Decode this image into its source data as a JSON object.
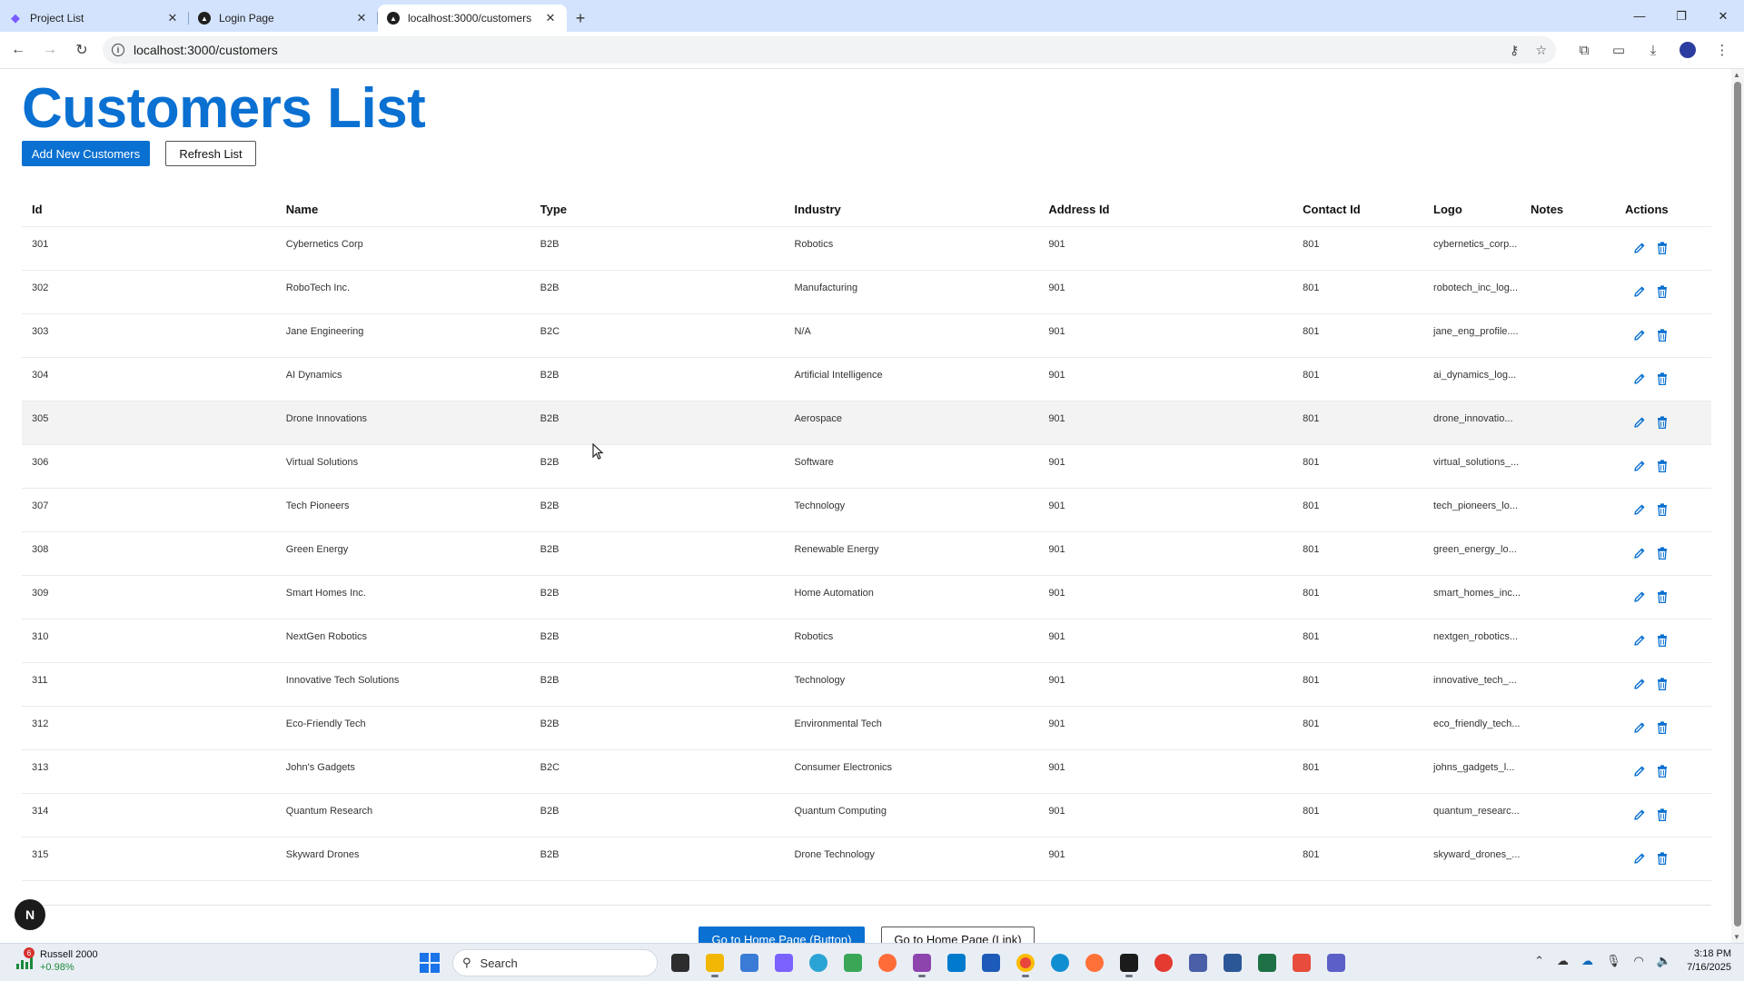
{
  "browser": {
    "tabs": [
      {
        "title": "Project List",
        "active": false
      },
      {
        "title": "Login Page",
        "active": false
      },
      {
        "title": "localhost:3000/customers",
        "active": true
      }
    ],
    "url": "localhost:3000/customers"
  },
  "page": {
    "title": "Customers List",
    "add_button": "Add New Customers",
    "refresh_button": "Refresh List",
    "home_button": "Go to Home Page (Button)",
    "home_link": "Go to Home Page (Link)",
    "next_badge": "N"
  },
  "table": {
    "headers": [
      "Id",
      "Name",
      "Type",
      "Industry",
      "Address Id",
      "Contact Id",
      "Logo",
      "Notes",
      "Actions"
    ],
    "rows": [
      {
        "id": "301",
        "name": "Cybernetics Corp",
        "type": "B2B",
        "industry": "Robotics",
        "address_id": "901",
        "contact_id": "801",
        "logo": "cybernetics_corp...",
        "notes": ""
      },
      {
        "id": "302",
        "name": "RoboTech Inc.",
        "type": "B2B",
        "industry": "Manufacturing",
        "address_id": "901",
        "contact_id": "801",
        "logo": "robotech_inc_log...",
        "notes": ""
      },
      {
        "id": "303",
        "name": "Jane Engineering",
        "type": "B2C",
        "industry": "N/A",
        "address_id": "901",
        "contact_id": "801",
        "logo": "jane_eng_profile....",
        "notes": ""
      },
      {
        "id": "304",
        "name": "AI Dynamics",
        "type": "B2B",
        "industry": "Artificial Intelligence",
        "address_id": "901",
        "contact_id": "801",
        "logo": "ai_dynamics_log...",
        "notes": ""
      },
      {
        "id": "305",
        "name": "Drone Innovations",
        "type": "B2B",
        "industry": "Aerospace",
        "address_id": "901",
        "contact_id": "801",
        "logo": "drone_innovatio...",
        "notes": ""
      },
      {
        "id": "306",
        "name": "Virtual Solutions",
        "type": "B2B",
        "industry": "Software",
        "address_id": "901",
        "contact_id": "801",
        "logo": "virtual_solutions_...",
        "notes": ""
      },
      {
        "id": "307",
        "name": "Tech Pioneers",
        "type": "B2B",
        "industry": "Technology",
        "address_id": "901",
        "contact_id": "801",
        "logo": "tech_pioneers_lo...",
        "notes": ""
      },
      {
        "id": "308",
        "name": "Green Energy",
        "type": "B2B",
        "industry": "Renewable Energy",
        "address_id": "901",
        "contact_id": "801",
        "logo": "green_energy_lo...",
        "notes": ""
      },
      {
        "id": "309",
        "name": "Smart Homes Inc.",
        "type": "B2B",
        "industry": "Home Automation",
        "address_id": "901",
        "contact_id": "801",
        "logo": "smart_homes_inc...",
        "notes": ""
      },
      {
        "id": "310",
        "name": "NextGen Robotics",
        "type": "B2B",
        "industry": "Robotics",
        "address_id": "901",
        "contact_id": "801",
        "logo": "nextgen_robotics...",
        "notes": ""
      },
      {
        "id": "311",
        "name": "Innovative Tech Solutions",
        "type": "B2B",
        "industry": "Technology",
        "address_id": "901",
        "contact_id": "801",
        "logo": "innovative_tech_...",
        "notes": ""
      },
      {
        "id": "312",
        "name": "Eco-Friendly Tech",
        "type": "B2B",
        "industry": "Environmental Tech",
        "address_id": "901",
        "contact_id": "801",
        "logo": "eco_friendly_tech...",
        "notes": ""
      },
      {
        "id": "313",
        "name": "John's Gadgets",
        "type": "B2C",
        "industry": "Consumer Electronics",
        "address_id": "901",
        "contact_id": "801",
        "logo": "johns_gadgets_l...",
        "notes": ""
      },
      {
        "id": "314",
        "name": "Quantum Research",
        "type": "B2B",
        "industry": "Quantum Computing",
        "address_id": "901",
        "contact_id": "801",
        "logo": "quantum_researc...",
        "notes": ""
      },
      {
        "id": "315",
        "name": "Skyward Drones",
        "type": "B2B",
        "industry": "Drone Technology",
        "address_id": "901",
        "contact_id": "801",
        "logo": "skyward_drones_...",
        "notes": ""
      }
    ],
    "highlighted_row_id": "305"
  },
  "taskbar": {
    "ticker_name": "Russell 2000",
    "ticker_change": "+0.98%",
    "ticker_badge": "6",
    "search_placeholder": "Search",
    "time": "3:18 PM",
    "date": "7/16/2025"
  },
  "colors": {
    "accent": "#0a70d1",
    "tab_bar": "#d3e3fd",
    "positive": "#1b8a3a"
  }
}
